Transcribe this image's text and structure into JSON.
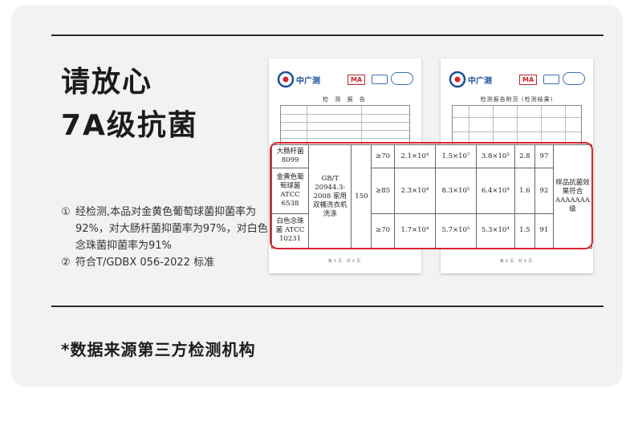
{
  "headline": {
    "line1": "请放心",
    "line2": "7A级抗菌"
  },
  "notes": [
    {
      "num": "①",
      "text": "经检测,本品对金黄色葡萄球菌抑菌率为92%，对大肠杆菌抑菌率为97%，对白色念珠菌抑菌率为91%"
    },
    {
      "num": "②",
      "text": "符合T/GDBX 056-2022 标准"
    }
  ],
  "source_note": "*数据来源第三方检测机构",
  "report": {
    "brand": "中广测",
    "ma_mark": "MA",
    "title_left": "检 测 报 告",
    "title_right": "检测报告附页 (检测结果)",
    "footer": "第X页 共X页"
  },
  "results_table": {
    "rows": [
      {
        "organism": "大肠杆菌 8099",
        "requirement": "≥70",
        "control": "2.1×10⁴",
        "sample_a": "1.5×10⁷",
        "sample_b": "3.8×10⁵",
        "log": "2.8",
        "rate": "97"
      },
      {
        "organism": "金黄色葡萄球菌 ATCC 6538",
        "requirement": "≥85",
        "control": "2.3×10⁴",
        "sample_a": "8.3×10⁵",
        "sample_b": "6.4×10⁴",
        "log": "1.6",
        "rate": "92"
      },
      {
        "organism": "白色念珠菌 ATCC 10231",
        "requirement": "≥70",
        "control": "1.7×10⁴",
        "sample_a": "5.7×10⁵",
        "sample_b": "5.3×10⁴",
        "log": "1.5",
        "rate": "91"
      }
    ],
    "method": "GB/T 20944.3-2008 家用双桶洗衣机洗涤",
    "count": "150",
    "conclusion": "样品抗菌效果符合AAAAAAA级"
  },
  "colors": {
    "highlight": "#d7252f",
    "brand_blue": "#1a4f9c",
    "card_bg": "#f2f2f2"
  }
}
